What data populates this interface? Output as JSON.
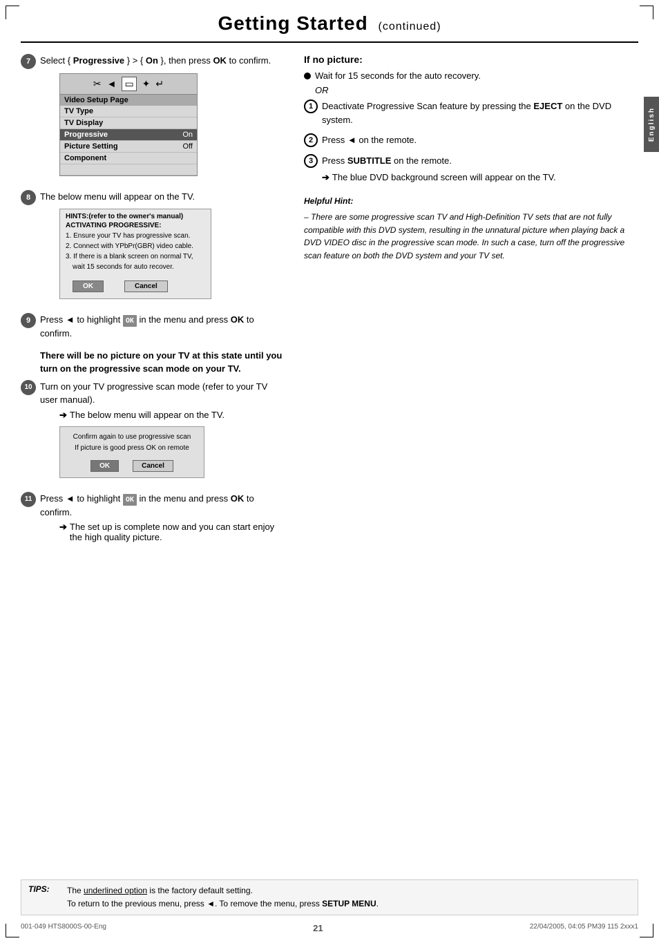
{
  "page": {
    "title": "Getting Started",
    "subtitle": "(continued)",
    "page_number": "21"
  },
  "english_tab": "English",
  "left_column": {
    "steps": [
      {
        "id": "step7",
        "number": "7",
        "type": "circle",
        "text_parts": [
          "Select { ",
          "Progressive",
          " } > { ",
          "On",
          " }, then press ",
          "OK",
          " to confirm."
        ],
        "text_bold": [
          false,
          true,
          false,
          true,
          false,
          true,
          false
        ],
        "menu": {
          "type": "vsp",
          "icons": [
            "✂",
            "◄",
            "▭",
            "✦",
            "↵"
          ],
          "title": "Video Setup Page",
          "rows": [
            {
              "label": "TV Type",
              "value": "",
              "highlighted": false
            },
            {
              "label": "TV Display",
              "value": "",
              "highlighted": false
            },
            {
              "label": "Progressive",
              "value": "On",
              "highlighted": true
            },
            {
              "label": "Picture Setting",
              "value": "Off",
              "highlighted": false
            },
            {
              "label": "Component",
              "value": "",
              "highlighted": false
            }
          ]
        }
      },
      {
        "id": "step8",
        "number": "8",
        "type": "circle",
        "text": "The below menu will appear on the TV.",
        "hints_box": {
          "title": "HINTS:(refer to the owner's manual)",
          "subtitle": "ACTIVATING PROGRESSIVE:",
          "lines": [
            "1. Ensure your TV has progressive scan.",
            "2. Connect with YPbPr(GBR) video cable.",
            "3. If there is a blank screen on normal TV,",
            "   wait 15 seconds for auto recover."
          ],
          "buttons": [
            "OK",
            "Cancel"
          ]
        }
      },
      {
        "id": "step9",
        "number": "9",
        "type": "circle",
        "text_before_ok": "Press ◄ to highlight ",
        "ok_badge": "OK",
        "text_after_ok": " in the menu and press ",
        "ok_bold": "OK",
        "text_end": " to confirm."
      },
      {
        "id": "warning",
        "type": "warning",
        "text": "There will be no picture on your TV at this state until you turn on the progressive scan mode on your TV."
      },
      {
        "id": "step10",
        "number": "10",
        "type": "circle-filled",
        "text": "Turn on your TV progressive scan mode (refer to your TV user manual).",
        "sub_arrow": "The below menu will appear on the TV.",
        "confirm_box": {
          "lines": [
            "Confirm again to use progressive scan",
            "If picture is good press OK on remote"
          ],
          "buttons": [
            "OK",
            "Cancel"
          ]
        }
      },
      {
        "id": "step11",
        "number": "11",
        "type": "circle-filled",
        "text_before_ok": "Press ◄ to highlight ",
        "ok_badge": "OK",
        "text_after_ok": " in the menu and press ",
        "ok_bold": "OK",
        "text_end": " to confirm.",
        "sub_arrow": "The set up is complete now and you can start enjoy the high quality picture."
      }
    ]
  },
  "right_column": {
    "if_no_picture": {
      "title": "If no picture:",
      "bullet1": "Wait for 15 seconds for the auto recovery.",
      "or_text": "OR",
      "steps": [
        {
          "number": "1",
          "type": "circle-white",
          "text_parts": [
            "Deactivate Progressive Scan feature by pressing the ",
            "EJECT",
            " on the DVD system."
          ]
        },
        {
          "number": "2",
          "type": "circle-white",
          "text_parts": [
            "Press ◄ on the remote."
          ]
        },
        {
          "number": "3",
          "type": "circle-white",
          "text_parts": [
            "Press ",
            "SUBTITLE",
            " on the remote."
          ],
          "sub_arrow": "The blue DVD background screen will appear on the TV."
        }
      ]
    },
    "helpful_hint": {
      "title": "Helpful Hint:",
      "text": "– There are some progressive scan TV and High-Definition TV sets that are not fully compatible with this DVD system, resulting in the unnatural picture when playing back a DVD VIDEO disc in the progressive scan mode. In such a case, turn off the progressive scan feature on both the DVD system and your TV set."
    }
  },
  "tips_bar": {
    "label": "TIPS:",
    "line1": "The underlined option is the factory default setting.",
    "line2_prefix": "To return to the previous menu, press ◄.  To remove the menu, press ",
    "line2_bold": "SETUP MENU",
    "line2_suffix": "."
  },
  "footer": {
    "left": "001-049 HTS8000S-00-Eng",
    "center": "21",
    "right": "22/04/2005, 04:05 PM39 115 2xxx1"
  }
}
